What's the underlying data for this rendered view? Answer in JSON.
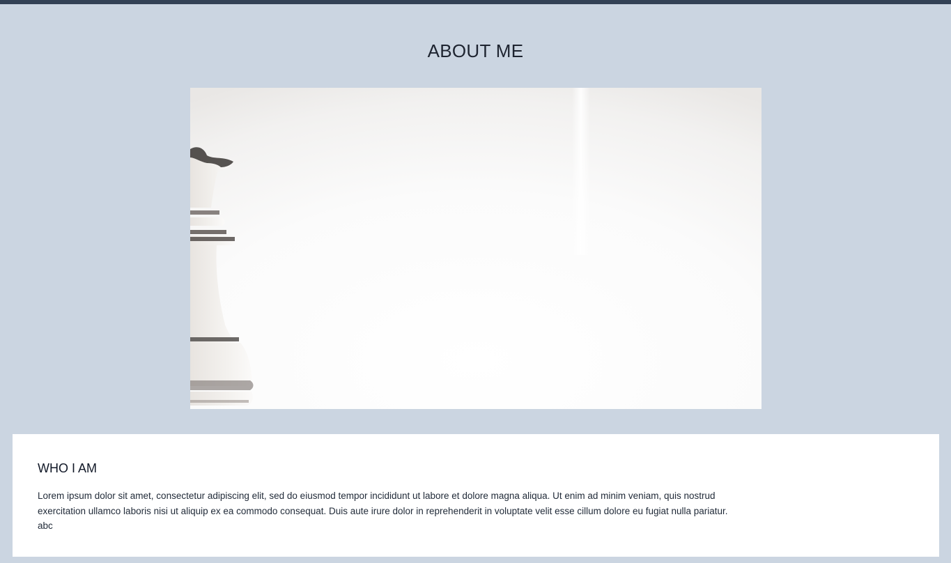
{
  "header": {
    "title": "ABOUT ME"
  },
  "hero_image": {
    "alt": "chess-queen-photo",
    "subject_icon": "chess-queen"
  },
  "about_card": {
    "heading": "WHO I AM",
    "body": "Lorem ipsum dolor sit amet, consectetur adipiscing elit, sed do eiusmod tempor incididunt ut labore et dolore magna aliqua. Ut enim ad minim veniam, quis nostrud exercitation ullamco laboris nisi ut aliquip ex ea commodo consequat. Duis aute irure dolor in reprehenderit in voluptate velit esse cillum dolore eu fugiat nulla pariatur. abc"
  },
  "colors": {
    "page_background": "#cbd5e1",
    "top_bar": "#334155",
    "card_background": "#ffffff"
  }
}
